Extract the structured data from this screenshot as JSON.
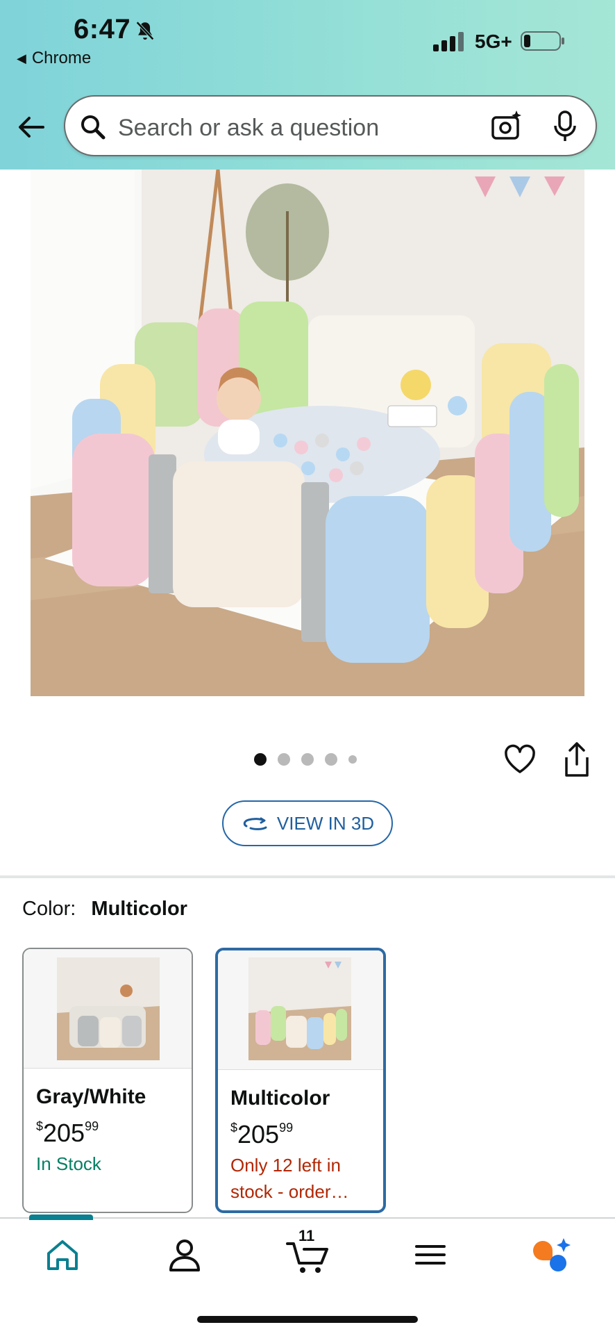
{
  "status_bar": {
    "time": "6:47",
    "back_app": "Chrome",
    "network": "5G+"
  },
  "search": {
    "placeholder": "Search or ask a question"
  },
  "gallery": {
    "image_count": 5,
    "active_index": 0
  },
  "view3d_label": "VIEW IN 3D",
  "color_selector": {
    "label": "Color:",
    "selected": "Multicolor"
  },
  "variants": [
    {
      "name": "Gray/White",
      "currency": "$",
      "price_whole": "205",
      "price_fraction": "99",
      "stock": "In Stock"
    },
    {
      "name": "Multicolor",
      "currency": "$",
      "price_whole": "205",
      "price_fraction": "99",
      "stock": "Only 12 left in stock - order…"
    }
  ],
  "bottom_nav": {
    "cart_count": "11"
  },
  "colors": {
    "header_teal": "#93dfd7",
    "link_blue": "#2567a8",
    "in_stock_green": "#057f62",
    "low_stock_red": "#b12704",
    "selected_border": "#2d6aa3"
  }
}
